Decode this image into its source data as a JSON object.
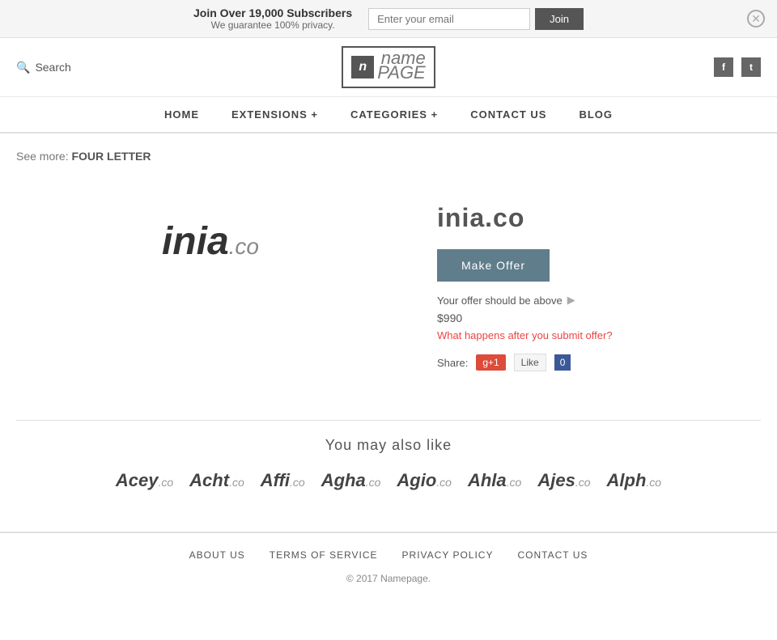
{
  "topBanner": {
    "headline": "Join Over 19,000 Subscribers",
    "subline": "We guarantee 100% privacy.",
    "emailPlaceholder": "Enter your email",
    "joinLabel": "Join"
  },
  "header": {
    "searchLabel": "Search",
    "logoLetterMark": "n",
    "logoName": "name",
    "logoPage": "PAGE",
    "facebookIcon": "f",
    "twitterIcon": "t"
  },
  "nav": {
    "items": [
      {
        "label": "HOME",
        "id": "home"
      },
      {
        "label": "EXTENSIONS +",
        "id": "extensions"
      },
      {
        "label": "CATEGORIES +",
        "id": "categories"
      },
      {
        "label": "CONTACT US",
        "id": "contact"
      },
      {
        "label": "BLOG",
        "id": "blog"
      }
    ]
  },
  "breadcrumb": {
    "prefix": "See more:",
    "value": "FOUR LETTER"
  },
  "domain": {
    "name": "inia",
    "tld": ".co",
    "full": "inia.co",
    "makeOfferLabel": "Make Offer",
    "offerInfo": "Your offer should be above",
    "offerPrice": "$990",
    "offerQuestion": "What happens after you submit offer?",
    "shareLabel": "Share:",
    "gPlusLabel": "g+1",
    "fbLikeLabel": "Like",
    "fbCount": "0"
  },
  "alsoLike": {
    "heading": "You may also like",
    "items": [
      {
        "name": "Acey",
        "tld": ".co"
      },
      {
        "name": "Acht",
        "tld": ".co"
      },
      {
        "name": "Affi",
        "tld": ".co"
      },
      {
        "name": "Agha",
        "tld": ".co"
      },
      {
        "name": "Agio",
        "tld": ".co"
      },
      {
        "name": "Ahla",
        "tld": ".co"
      },
      {
        "name": "Ajes",
        "tld": ".co"
      },
      {
        "name": "Alph",
        "tld": ".co"
      }
    ]
  },
  "footer": {
    "links": [
      {
        "label": "ABOUT US",
        "id": "about"
      },
      {
        "label": "TERMS OF SERVICE",
        "id": "tos"
      },
      {
        "label": "PRIVACY POLICY",
        "id": "privacy"
      },
      {
        "label": "CONTACT US",
        "id": "contact"
      }
    ],
    "copyright": "© 2017",
    "brand": "Namepage."
  }
}
